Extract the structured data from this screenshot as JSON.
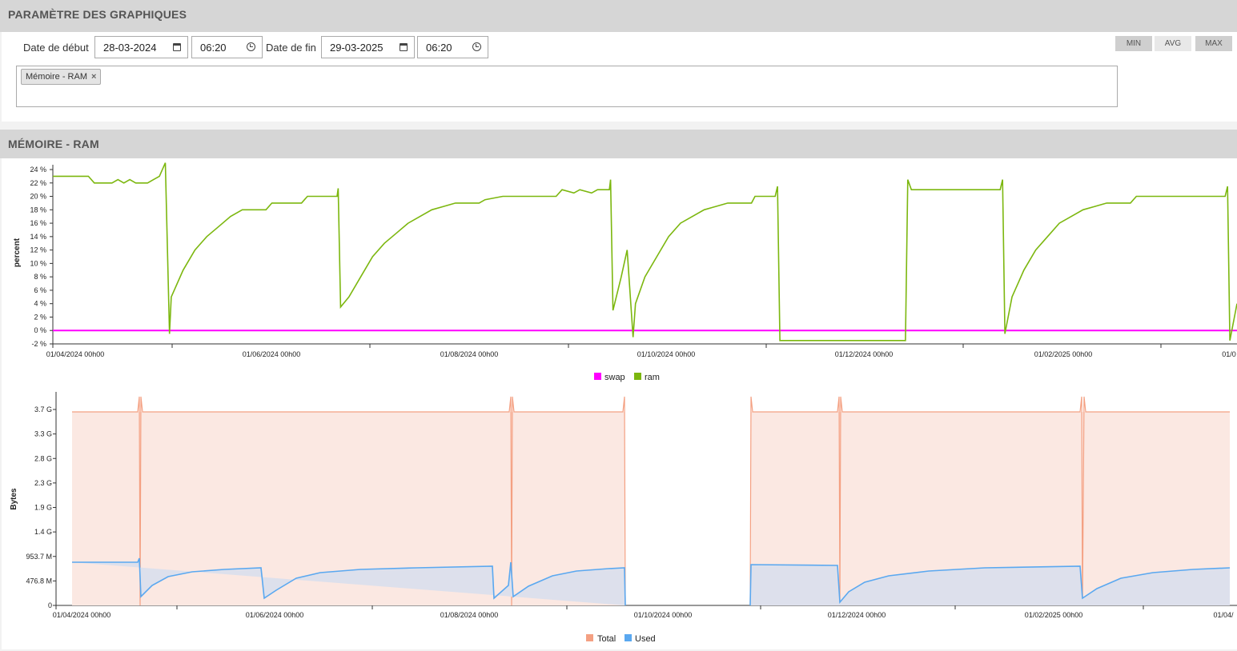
{
  "settings": {
    "title": "PARAMÈTRE DES GRAPHIQUES",
    "start_label": "Date de début",
    "start_date": "28-03-2024",
    "start_time": "06:20",
    "end_label": "Date de fin",
    "end_date": "29-03-2025",
    "end_time": "06:20",
    "buttons": [
      "MIN",
      "AVG",
      "MAX"
    ],
    "tag": "Mémoire - RAM"
  },
  "memory": {
    "title": "MÉMOIRE - RAM"
  },
  "chart_data": [
    {
      "type": "line",
      "ylabel": "percent",
      "ylim": [
        -2,
        24
      ],
      "y_ticks": [
        "24 %",
        "22 %",
        "20 %",
        "18 %",
        "16 %",
        "14 %",
        "12 %",
        "10 %",
        "8 %",
        "6 %",
        "4 %",
        "2 %",
        "0 %",
        "-2 %"
      ],
      "x_ticks": [
        "01/04/2024 00h00",
        "01/06/2024 00h00",
        "01/08/2024 00h00",
        "01/10/2024 00h00",
        "01/12/2024 00h00",
        "01/02/2025 00h00",
        "01/0"
      ],
      "legend": "bottom-center",
      "series": [
        {
          "name": "swap",
          "color": "#ff00ff",
          "values": [
            [
              0,
              0
            ],
            [
              1,
              0
            ]
          ]
        },
        {
          "name": "ram",
          "color": "#7cb70f",
          "values": [
            [
              0,
              23
            ],
            [
              0.03,
              23
            ],
            [
              0.035,
              22
            ],
            [
              0.05,
              22
            ],
            [
              0.055,
              22.5
            ],
            [
              0.06,
              22
            ],
            [
              0.065,
              22.5
            ],
            [
              0.07,
              22
            ],
            [
              0.08,
              22
            ],
            [
              0.085,
              22.5
            ],
            [
              0.09,
              23
            ],
            [
              0.095,
              25
            ],
            [
              0.0985,
              -0.5
            ],
            [
              0.1,
              5
            ],
            [
              0.11,
              9
            ],
            [
              0.12,
              12
            ],
            [
              0.13,
              14
            ],
            [
              0.14,
              15.5
            ],
            [
              0.15,
              17
            ],
            [
              0.16,
              18
            ],
            [
              0.18,
              18
            ],
            [
              0.185,
              19
            ],
            [
              0.21,
              19
            ],
            [
              0.215,
              20
            ],
            [
              0.24,
              20
            ],
            [
              0.241,
              21.2
            ],
            [
              0.243,
              3.5
            ],
            [
              0.25,
              5
            ],
            [
              0.26,
              8
            ],
            [
              0.27,
              11
            ],
            [
              0.28,
              13
            ],
            [
              0.29,
              14.5
            ],
            [
              0.3,
              16
            ],
            [
              0.31,
              17
            ],
            [
              0.32,
              18
            ],
            [
              0.33,
              18.5
            ],
            [
              0.34,
              19
            ],
            [
              0.36,
              19
            ],
            [
              0.365,
              19.5
            ],
            [
              0.38,
              20
            ],
            [
              0.425,
              20
            ],
            [
              0.43,
              21
            ],
            [
              0.44,
              20.5
            ],
            [
              0.445,
              21
            ],
            [
              0.455,
              20.5
            ],
            [
              0.46,
              21
            ],
            [
              0.47,
              21
            ],
            [
              0.471,
              22.5
            ],
            [
              0.473,
              3
            ],
            [
              0.48,
              8
            ],
            [
              0.485,
              12
            ],
            [
              0.49,
              -1
            ],
            [
              0.492,
              4
            ],
            [
              0.5,
              8
            ],
            [
              0.51,
              11
            ],
            [
              0.52,
              14
            ],
            [
              0.53,
              16
            ],
            [
              0.54,
              17
            ],
            [
              0.55,
              18
            ],
            [
              0.56,
              18.5
            ],
            [
              0.57,
              19
            ],
            [
              0.59,
              19
            ],
            [
              0.593,
              20
            ],
            [
              0.61,
              20
            ],
            [
              0.612,
              21.5
            ],
            [
              0.614,
              -1.5
            ],
            [
              0.72,
              -1.5
            ],
            [
              0.722,
              22.5
            ],
            [
              0.725,
              21
            ],
            [
              0.8,
              21
            ],
            [
              0.802,
              22.5
            ],
            [
              0.804,
              -0.5
            ],
            [
              0.81,
              5
            ],
            [
              0.82,
              9
            ],
            [
              0.83,
              12
            ],
            [
              0.84,
              14
            ],
            [
              0.85,
              16
            ],
            [
              0.86,
              17
            ],
            [
              0.87,
              18
            ],
            [
              0.88,
              18.5
            ],
            [
              0.89,
              19
            ],
            [
              0.91,
              19
            ],
            [
              0.915,
              20
            ],
            [
              0.99,
              20
            ],
            [
              0.992,
              21.5
            ],
            [
              0.994,
              -1.5
            ],
            [
              1.0,
              4
            ]
          ]
        }
      ]
    },
    {
      "type": "area",
      "ylabel": "Bytes",
      "y_ticks": [
        "3.7 G",
        "3.3 G",
        "2.8 G",
        "2.3 G",
        "1.9 G",
        "1.4 G",
        "953.7 M",
        "476.8 M",
        "0"
      ],
      "x_ticks": [
        "01/04/2024 00h00",
        "01/06/2024 00h00",
        "01/08/2024 00h00",
        "01/10/2024 00h00",
        "01/12/2024 00h00",
        "01/02/2025 00h00",
        "01/04/"
      ],
      "legend": "bottom-center",
      "series": [
        {
          "name": "Total",
          "color": "#f4a082"
        },
        {
          "name": "Used",
          "color": "#5aa8f0"
        }
      ]
    }
  ]
}
